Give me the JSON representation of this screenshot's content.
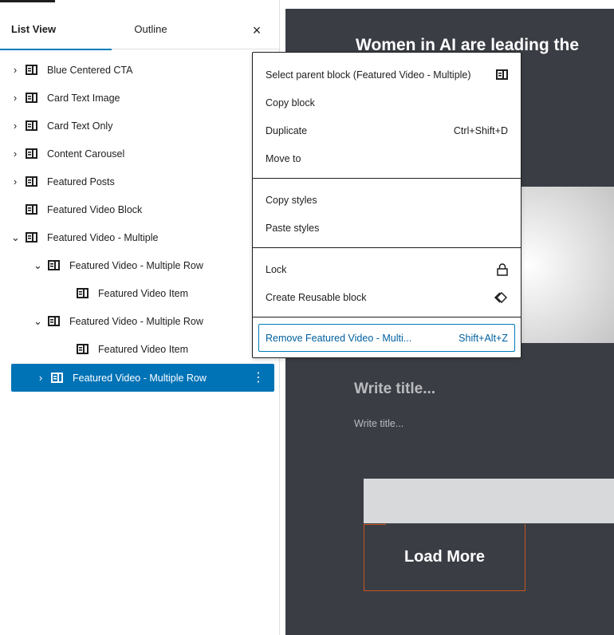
{
  "sidebar": {
    "tabs": {
      "list_view": "List View",
      "outline": "Outline"
    },
    "close_glyph": "×",
    "expand_glyph": "›",
    "collapse_glyph": "⌄",
    "kebab_glyph": "⋮",
    "items": [
      {
        "label": "Blue Centered CTA",
        "state": "collapsed",
        "depth": 0
      },
      {
        "label": "Card Text Image",
        "state": "collapsed",
        "depth": 0
      },
      {
        "label": "Card Text Only",
        "state": "collapsed",
        "depth": 0
      },
      {
        "label": "Content Carousel",
        "state": "collapsed",
        "depth": 0
      },
      {
        "label": "Featured Posts",
        "state": "collapsed",
        "depth": 0
      },
      {
        "label": "Featured Video Block",
        "state": "leaf",
        "depth": 0
      },
      {
        "label": "Featured Video - Multiple",
        "state": "expanded",
        "depth": 0
      },
      {
        "label": "Featured Video - Multiple Row",
        "state": "expanded",
        "depth": 1
      },
      {
        "label": "Featured Video Item",
        "state": "leaf",
        "depth": 2
      },
      {
        "label": "Featured Video - Multiple Row",
        "state": "expanded",
        "depth": 1
      },
      {
        "label": "Featured Video Item",
        "state": "leaf",
        "depth": 2
      },
      {
        "label": "Featured Video - Multiple Row",
        "state": "collapsed",
        "depth": 1,
        "selected": true
      }
    ]
  },
  "context_menu": {
    "items": [
      {
        "label": "Select parent block (Featured Video - Multiple)",
        "icon": "block-icon"
      },
      {
        "label": "Copy block"
      },
      {
        "label": "Duplicate",
        "shortcut": "Ctrl+Shift+D"
      },
      {
        "label": "Move to"
      },
      {
        "label": "Copy styles"
      },
      {
        "label": "Paste styles"
      },
      {
        "label": "Lock",
        "icon": "lock-icon"
      },
      {
        "label": "Create Reusable block",
        "icon": "reusable-block-icon"
      },
      {
        "label": "Remove Featured Video - Multi...",
        "shortcut": "Shift+Alt+Z"
      }
    ]
  },
  "canvas": {
    "heading": "Women in AI are leading the",
    "title_placeholder": "Write title...",
    "subtitle_placeholder": "Write title...",
    "load_more": "Load More"
  },
  "colors": {
    "accent": "#007cba",
    "selected_row": "#0073b7",
    "canvas_bg": "#3a3d44",
    "button_border": "#c8541f"
  }
}
